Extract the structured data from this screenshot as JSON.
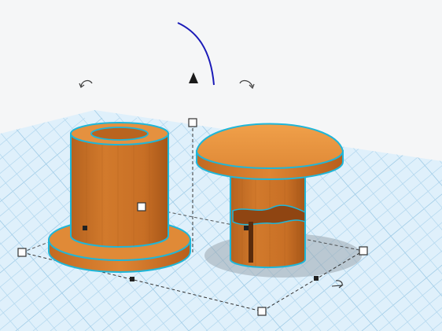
{
  "viewport": {
    "background": "#f5f6f7",
    "workplane_color": "#dff0fb",
    "grid_line_color": "#b6d9ef",
    "grid_major_color": "#9fcbe6"
  },
  "shapes": [
    {
      "name": "bushing-shape",
      "color": "#e08a37",
      "selected": true
    },
    {
      "name": "mushroom-pin-shape",
      "color": "#e08a37",
      "selected": true
    }
  ],
  "selection": {
    "outline_color": "#1fb6d8",
    "box_line_color": "#333333"
  },
  "gizmo": {
    "rotate_arc_color": "#1b1bb8",
    "icons": [
      "rotate-left-icon",
      "rotate-right-icon",
      "move-up-cone-icon",
      "rotate-icon"
    ]
  }
}
